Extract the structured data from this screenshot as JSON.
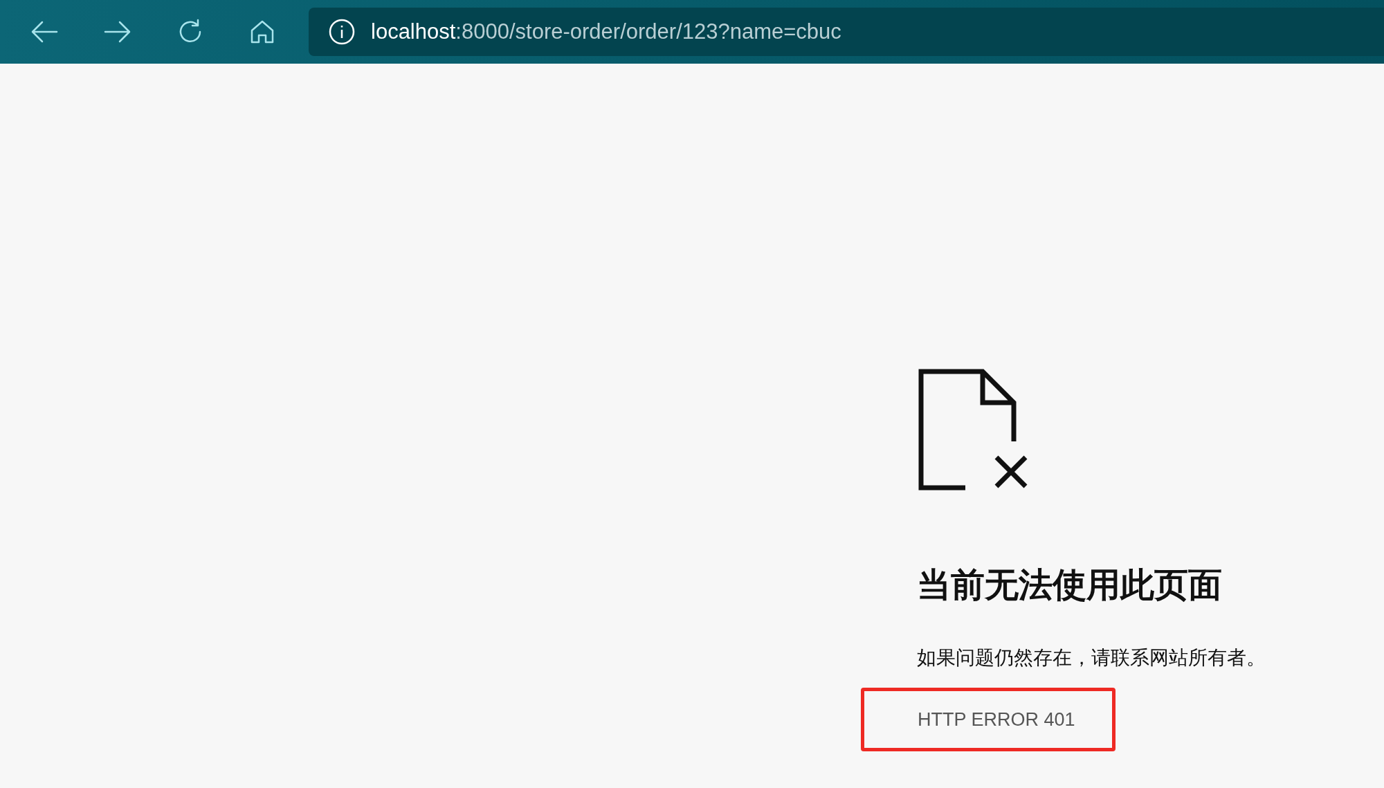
{
  "browser": {
    "url_host": "localhost",
    "url_rest": ":8000/store-order/order/123?name=cbuc"
  },
  "error": {
    "title": "当前无法使用此页面",
    "message": "如果问题仍然存在，请联系网站所有者。",
    "code": "HTTP ERROR 401",
    "code_highlighted": true
  }
}
